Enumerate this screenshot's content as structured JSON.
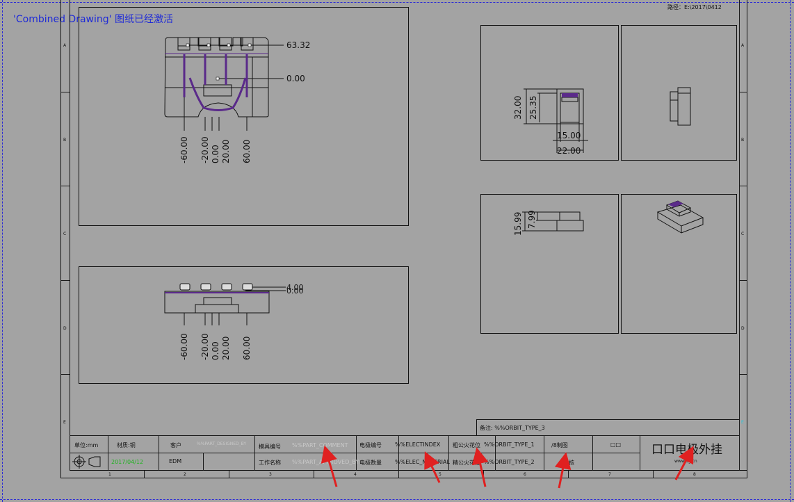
{
  "status_message": "'Combined Drawing' 图纸已经激活",
  "path_label": "路径：E:\\2017\\0412",
  "zones_left": [
    "A",
    "B",
    "C",
    "D",
    "E"
  ],
  "zones_right": [
    "A",
    "B",
    "C",
    "D",
    "E"
  ],
  "columns": [
    "1",
    "2",
    "3",
    "4",
    "5",
    "6",
    "7",
    "8"
  ],
  "top_view": {
    "dim_top": "63.32",
    "dim_mid": "0.00",
    "x_dims": [
      "-60.00",
      "-20.00",
      "0.00",
      "20.00",
      "60.00"
    ]
  },
  "front_view": {
    "dim_a": "4.00",
    "dim_b": "0.00",
    "x_dims": [
      "-60.00",
      "-20.00",
      "0.00",
      "20.00",
      "60.00"
    ]
  },
  "detail_front": {
    "v1": "32.00",
    "v2": "25.35",
    "h1": "15.00",
    "h2": "22.00"
  },
  "detail_side": {
    "v1": "15.99",
    "v2": "7.99"
  },
  "title_block": {
    "remark": "备注: %%ORBIT_TYPE_3",
    "unit": "单位:mm",
    "material": "材质:铜",
    "customer": "客户",
    "designer_field": "%%PART_DESIGNED_BY",
    "mold_no_label": "模具编号",
    "mold_no_value": "%%PART_COMMENT",
    "electrode_no_label": "电极编号",
    "electrode_no_value": "%%ELECTINDEX",
    "coarse_spark_label": "粗公火花位",
    "coarse_spark_value": "%%ORBIT_TYPE_1",
    "drafter_label": "/8制图",
    "approve_label": "审核",
    "date_field": "□□",
    "process_label": "EDM",
    "work_label": "工作名称",
    "work_value": "%%PART_APPROVED_BY",
    "electrode_qty_label": "电极数量",
    "electrode_qty_value": "%%ELEC_MATERIAL",
    "fine_spark_label": "精公火花位",
    "fine_spark_value": "%%ORBIT_TYPE_2",
    "date_green": "2017/04/12",
    "big_title": "口口电极外挂",
    "company_small": "www.ug.cn"
  },
  "colors": {
    "background": "#a3a3a3",
    "status_text": "#1e2ad8",
    "arrow": "#e02020",
    "hatch": "#5a2a8a"
  }
}
